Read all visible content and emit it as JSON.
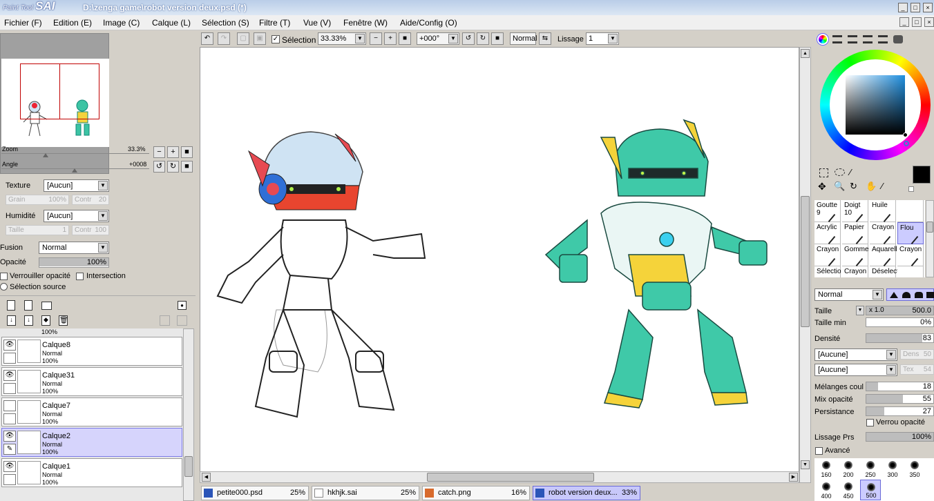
{
  "window": {
    "app_name": "SAI",
    "app_name_prefix": "Paint Tool",
    "title": "D:\\zenga game\\robot version deux.psd (*)"
  },
  "menu": [
    {
      "label": "Fichier (F)"
    },
    {
      "label": "Edition (E)"
    },
    {
      "label": "Image (C)"
    },
    {
      "label": "Calque (L)"
    },
    {
      "label": "Sélection (S)"
    },
    {
      "label": "Filtre (T)"
    },
    {
      "label": "Vue (V)"
    },
    {
      "label": "Fenêtre (W)"
    },
    {
      "label": "Aide/Config (O)"
    }
  ],
  "navigator": {
    "zoom_label": "Zoom",
    "zoom_value": "33.3%",
    "angle_label": "Angle",
    "angle_value": "+0008"
  },
  "texture": {
    "label": "Texture",
    "value": "[Aucun]",
    "grain_label": "Grain",
    "grain_value": "100%",
    "contr_label": "Contr",
    "contr_value": "20"
  },
  "humidity": {
    "label": "Humidité",
    "value": "[Aucun]",
    "size_label": "Taille",
    "size_value": "1",
    "contr_label": "Contr",
    "contr_value": "100"
  },
  "blend": {
    "fusion_label": "Fusion",
    "fusion_value": "Normal",
    "opacity_label": "Opacité",
    "opacity_value": "100%",
    "opacity_fraction": 1.0,
    "lock_opacity_label": "Verrouiller opacité",
    "intersection_label": "Intersection",
    "source_selection_label": "Sélection source"
  },
  "layers": {
    "top_partial_opacity": "100%",
    "items": [
      {
        "name": "Calque8",
        "mode": "Normal",
        "opacity": "100%",
        "visible": true,
        "selected": false
      },
      {
        "name": "Calque31",
        "mode": "Normal",
        "opacity": "100%",
        "visible": true,
        "selected": false
      },
      {
        "name": "Calque7",
        "mode": "Normal",
        "opacity": "100%",
        "visible": false,
        "selected": false
      },
      {
        "name": "Calque2",
        "mode": "Normal",
        "opacity": "100%",
        "visible": true,
        "selected": true
      },
      {
        "name": "Calque1",
        "mode": "Normal",
        "opacity": "100%",
        "visible": true,
        "selected": false
      }
    ]
  },
  "toolbar": {
    "selection_label": "Sélection",
    "zoom_value": "33.33%",
    "angle_value": "+000°",
    "mode_value": "Normal",
    "smoothing_label": "Lissage",
    "smoothing_value": "1"
  },
  "tabs": [
    {
      "name": "petite000.psd",
      "percent": "25%",
      "active": false
    },
    {
      "name": "hkhjk.sai",
      "percent": "25%",
      "active": false
    },
    {
      "name": "catch.png",
      "percent": "16%",
      "active": false
    },
    {
      "name": "robot version deux...",
      "percent": "33%",
      "active": true
    }
  ],
  "tools": {
    "brushes": [
      {
        "name": "Goutte",
        "size": "9"
      },
      {
        "name": "Doigt",
        "size": "10"
      },
      {
        "name": "Huile",
        "size": ""
      },
      {
        "name": "",
        "size": ""
      },
      {
        "name": "Acrylic",
        "size": ""
      },
      {
        "name": "Papier",
        "size": ""
      },
      {
        "name": "Crayon",
        "size": ""
      },
      {
        "name": "Flou",
        "size": ""
      },
      {
        "name": "Crayon",
        "size": ""
      },
      {
        "name": "Gomme",
        "size": ""
      },
      {
        "name": "Aquarell",
        "size": ""
      },
      {
        "name": "Crayon",
        "size": ""
      },
      {
        "name": "Sélectio",
        "size": ""
      },
      {
        "name": "Crayon",
        "size": ""
      },
      {
        "name": "Déselect",
        "size": ""
      },
      {
        "name": "",
        "size": ""
      }
    ],
    "selected_brush": "Flou"
  },
  "brush_settings": {
    "mode_value": "Normal",
    "size_label": "Taille",
    "size_multiplier": "x 1.0",
    "size_value": "500.0",
    "min_size_label": "Taille min",
    "min_size_value": "0%",
    "min_size_fraction": 0.0,
    "density_label": "Densité",
    "density_value": "83",
    "density_fraction": 0.83,
    "texture1_value": "[Aucune]",
    "texture1_side_label": "Dens",
    "texture1_side_value": "50",
    "texture2_value": "[Aucune]",
    "texture2_side_label": "Tex",
    "texture2_side_value": "54",
    "blend_color_label": "Mélanges coul",
    "blend_color_value": "18",
    "blend_color_fraction": 0.18,
    "mix_opacity_label": "Mix opacité",
    "mix_opacity_value": "55",
    "mix_opacity_fraction": 0.55,
    "persistence_label": "Persistance",
    "persistence_value": "27",
    "persistence_fraction": 0.27,
    "lock_opacity_label": "Verrou opacité",
    "smooth_pressure_label": "Lissage Prs",
    "smooth_pressure_value": "100%",
    "smooth_pressure_fraction": 1.0,
    "advanced_label": "Avancé"
  },
  "brush_sizes": [
    "160",
    "200",
    "250",
    "300",
    "350",
    "400",
    "450",
    "500"
  ],
  "selected_brush_size": "500",
  "colors": {
    "primary": "#000000",
    "secondary": "#ffffff",
    "accent_selected": "#ccccff",
    "layer_selected": "#d6d4fc"
  }
}
